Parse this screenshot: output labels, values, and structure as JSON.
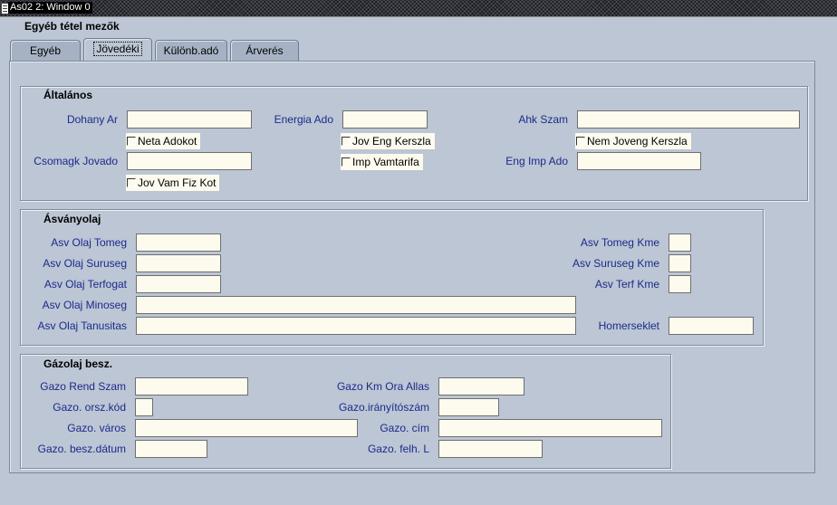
{
  "window": {
    "title": "As02 2: Window 0"
  },
  "form": {
    "title": "Egyéb tétel mezők"
  },
  "tabs": [
    {
      "label": "Egyéb"
    },
    {
      "label": "Jövedéki"
    },
    {
      "label": "Különb.adó"
    },
    {
      "label": "Árverés"
    }
  ],
  "altalanos": {
    "title": "Általános",
    "dohany_ar": "Dohany Ar",
    "energia_ado": "Energia Ado",
    "ahk_szam": "Ahk Szam",
    "neta_adokot": "Neta Adokot",
    "jov_eng_kerszla": "Jov Eng Kerszla",
    "nem_joveng_kerszla": "Nem Joveng Kerszla",
    "csomagk_jovado": "Csomagk Jovado",
    "imp_vamtarifa": "Imp Vamtarifa",
    "eng_imp_ado": "Eng Imp Ado",
    "jov_vam_fiz_kot": "Jov Vam Fiz Kot"
  },
  "asvanyolaj": {
    "title": "Ásványolaj",
    "tomeg": "Asv Olaj Tomeg",
    "suruseg": "Asv Olaj Suruseg",
    "terfogat": "Asv Olaj Terfogat",
    "minoseg": "Asv Olaj Minoseg",
    "tanusitas": "Asv Olaj Tanusitas",
    "tomeg_kme": "Asv Tomeg Kme",
    "suruseg_kme": "Asv Suruseg Kme",
    "terf_kme": "Asv Terf Kme",
    "homerseklet": "Homerseklet"
  },
  "gazolaj": {
    "title": "Gázolaj besz.",
    "rend_szam": "Gazo Rend Szam",
    "km_ora_allas": "Gazo Km Ora Allas",
    "orsz_kod": "Gazo. orsz.kód",
    "iranyitoszam": "Gazo.irányítószám",
    "varos": "Gazo. város",
    "cim": "Gazo. cím",
    "besz_datum": "Gazo. besz.dátum",
    "felh_l": "Gazo. felh. L"
  }
}
